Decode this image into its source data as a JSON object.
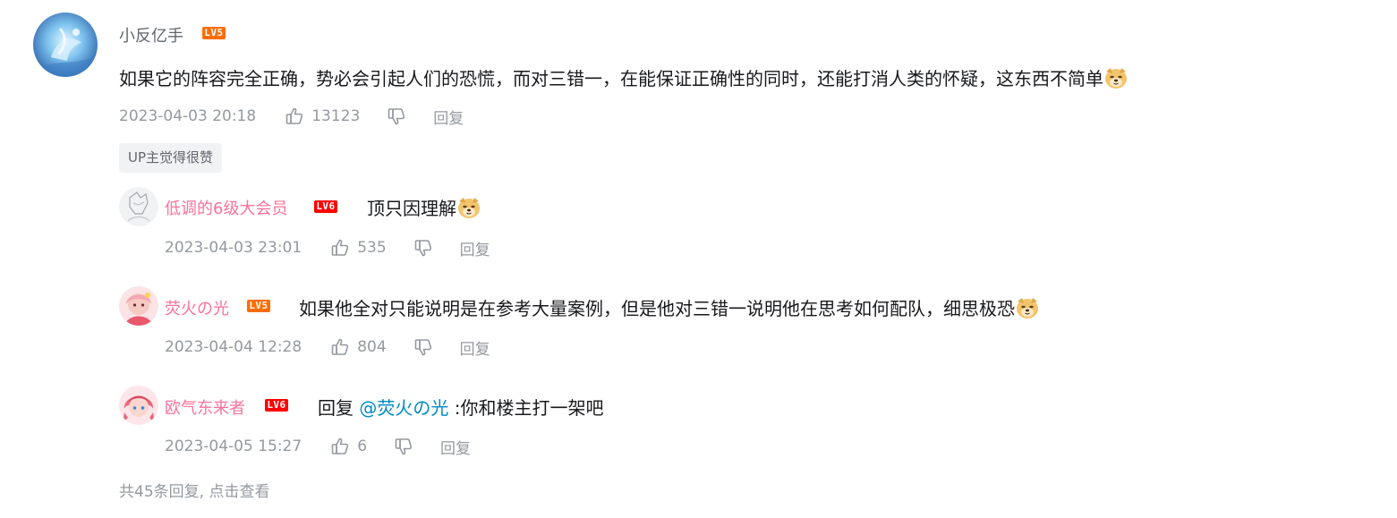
{
  "main_comment": {
    "username": "小反亿手",
    "level": "LV5",
    "content": "如果它的阵容完全正确，势必会引起人们的恐慌，而对三错一，在能保证正确性的同时，还能打消人类的怀疑，这东西不简单",
    "time": "2023-04-03 20:18",
    "likes": "13123",
    "reply_label": "回复",
    "up_badge": "UP主觉得很赞"
  },
  "replies": [
    {
      "username": "低调的6级大会员",
      "level": "LV6",
      "content": "顶只因理解",
      "time": "2023-04-03 23:01",
      "likes": "535",
      "reply_label": "回复"
    },
    {
      "username": "荧火の光",
      "level": "LV5",
      "content": "如果他全对只能说明是在参考大量案例，但是他对三错一说明他在思考如何配队，细思极恐",
      "time": "2023-04-04 12:28",
      "likes": "804",
      "reply_label": "回复"
    },
    {
      "username": "欧气东来者",
      "level": "LV6",
      "reply_prefix": "回复",
      "mention": "@荧火の光",
      "content": ":你和楼主打一架吧",
      "time": "2023-04-05 15:27",
      "likes": "6",
      "reply_label": "回复"
    }
  ],
  "more_replies": "共45条回复, 点击查看",
  "colors": {
    "vip_name": "#fb7299",
    "meta_gray": "#9499a0",
    "link_blue": "#008ac5",
    "lv5": "#ff6c00",
    "lv6": "#ff0000"
  },
  "icons": [
    "like-icon",
    "dislike-icon",
    "doge-emoji",
    "avatar"
  ]
}
